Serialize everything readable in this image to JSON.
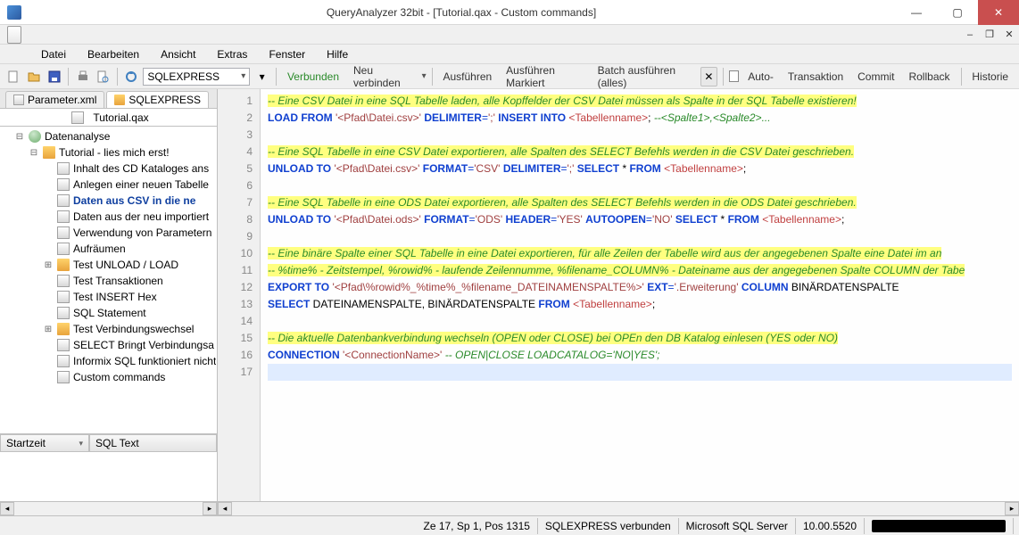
{
  "window": {
    "title": "QueryAnalyzer 32bit - [Tutorial.qax - Custom commands]"
  },
  "menu": [
    "Datei",
    "Bearbeiten",
    "Ansicht",
    "Extras",
    "Fenster",
    "Hilfe"
  ],
  "toolbar": {
    "connection": "SQLEXPRESS",
    "status": "Verbunden",
    "reconnect": "Neu verbinden",
    "execute": "Ausführen",
    "executeMarked": "Ausführen Markiert",
    "batchAll": "Batch ausführen (alles)",
    "auto": "Auto-",
    "transaction": "Transaktion",
    "commit": "Commit",
    "rollback": "Rollback",
    "history": "Historie"
  },
  "sidebar": {
    "tabs": [
      "Parameter.xml",
      "SQLEXPRESS"
    ],
    "file": "Tutorial.qax",
    "tree": {
      "root": "Datenanalyse",
      "tutorial": "Tutorial - lies mich erst!",
      "items": [
        "Inhalt des CD Kataloges ans",
        "Anlegen einer neuen Tabelle",
        "Daten aus CSV in die ne",
        "Daten aus der neu importiert",
        "Verwendung von Parametern",
        "Aufräumen",
        "Test UNLOAD / LOAD",
        "Test Transaktionen",
        "Test INSERT Hex",
        "SQL Statement",
        "Test Verbindungswechsel",
        "SELECT Bringt Verbindungsa",
        "Informix SQL funktioniert nicht",
        "Custom commands"
      ]
    },
    "grid": {
      "col1": "Startzeit",
      "col2": "SQL Text"
    }
  },
  "editor": {
    "lines": [
      {
        "n": 1,
        "hl": true,
        "seg": [
          {
            "c": "cm",
            "t": "-- Eine CSV Datei in eine SQL Tabelle laden, alle Kopffelder der CSV Datei müssen als Spalte in der SQL Tabelle existieren!"
          }
        ]
      },
      {
        "n": 2,
        "seg": [
          {
            "c": "kw",
            "t": "LOAD FROM"
          },
          {
            "t": " "
          },
          {
            "c": "st",
            "t": "'<Pfad\\Datei.csv>'"
          },
          {
            "t": " "
          },
          {
            "c": "kw",
            "t": "DELIMITER"
          },
          {
            "c": "op",
            "t": "="
          },
          {
            "c": "st",
            "t": "';'"
          },
          {
            "t": " "
          },
          {
            "c": "kw",
            "t": "INSERT INTO"
          },
          {
            "t": " "
          },
          {
            "c": "tag",
            "t": "<Tabellenname>"
          },
          {
            "t": "; "
          },
          {
            "c": "cm",
            "t": "--<Spalte1>,<Spalte2>..."
          }
        ]
      },
      {
        "n": 3,
        "seg": []
      },
      {
        "n": 4,
        "hl": true,
        "seg": [
          {
            "c": "cm",
            "t": "-- Eine SQL Tabelle in eine CSV Datei exportieren, alle Spalten des SELECT Befehls werden in die CSV Datei geschrieben."
          }
        ]
      },
      {
        "n": 5,
        "seg": [
          {
            "c": "kw",
            "t": "UNLOAD TO"
          },
          {
            "t": " "
          },
          {
            "c": "st",
            "t": "'<Pfad\\Datei.csv>'"
          },
          {
            "t": " "
          },
          {
            "c": "kw",
            "t": "FORMAT"
          },
          {
            "c": "op",
            "t": "="
          },
          {
            "c": "st",
            "t": "'CSV'"
          },
          {
            "t": " "
          },
          {
            "c": "kw",
            "t": "DELIMITER"
          },
          {
            "c": "op",
            "t": "="
          },
          {
            "c": "st",
            "t": "';'"
          },
          {
            "t": " "
          },
          {
            "c": "kw",
            "t": "SELECT"
          },
          {
            "t": " * "
          },
          {
            "c": "kw",
            "t": "FROM"
          },
          {
            "t": " "
          },
          {
            "c": "tag",
            "t": "<Tabellenname>"
          },
          {
            "t": ";"
          }
        ]
      },
      {
        "n": 6,
        "seg": []
      },
      {
        "n": 7,
        "hl": true,
        "seg": [
          {
            "c": "cm",
            "t": "-- Eine SQL Tabelle in eine ODS Datei exportieren, alle Spalten des SELECT Befehls werden in die ODS Datei geschrieben."
          }
        ]
      },
      {
        "n": 8,
        "seg": [
          {
            "c": "kw",
            "t": "UNLOAD TO"
          },
          {
            "t": " "
          },
          {
            "c": "st",
            "t": "'<Pfad\\Datei.ods>'"
          },
          {
            "t": " "
          },
          {
            "c": "kw",
            "t": "FORMAT"
          },
          {
            "c": "op",
            "t": "="
          },
          {
            "c": "st",
            "t": "'ODS'"
          },
          {
            "t": " "
          },
          {
            "c": "kw",
            "t": "HEADER"
          },
          {
            "c": "op",
            "t": "="
          },
          {
            "c": "st",
            "t": "'YES'"
          },
          {
            "t": " "
          },
          {
            "c": "kw",
            "t": "AUTOOPEN"
          },
          {
            "c": "op",
            "t": "="
          },
          {
            "c": "st",
            "t": "'NO'"
          },
          {
            "t": " "
          },
          {
            "c": "kw",
            "t": "SELECT"
          },
          {
            "t": " * "
          },
          {
            "c": "kw",
            "t": "FROM"
          },
          {
            "t": " "
          },
          {
            "c": "tag",
            "t": "<Tabellenname>"
          },
          {
            "t": ";"
          }
        ]
      },
      {
        "n": 9,
        "seg": []
      },
      {
        "n": 10,
        "hl": true,
        "seg": [
          {
            "c": "cm",
            "t": "-- Eine binäre Spalte einer SQL Tabelle in eine Datei exportieren, für alle Zeilen der Tabelle wird aus der angegebenen Spalte eine Datei im an"
          }
        ]
      },
      {
        "n": 11,
        "hl": true,
        "seg": [
          {
            "c": "cm",
            "t": "-- %time% - Zeitstempel, %rowid% - laufende Zeilennumme, %filename_COLUMN% - Dateiname aus der angegebenen Spalte COLUMN der Tabe"
          }
        ]
      },
      {
        "n": 12,
        "seg": [
          {
            "c": "kw",
            "t": "EXPORT TO"
          },
          {
            "t": " "
          },
          {
            "c": "st",
            "t": "'<Pfad\\%rowid%_%time%_%filename_DATEINAMENSPALTE%>'"
          },
          {
            "t": " "
          },
          {
            "c": "kw",
            "t": "EXT"
          },
          {
            "c": "op",
            "t": "="
          },
          {
            "c": "st",
            "t": "'.Erweiterung'"
          },
          {
            "t": " "
          },
          {
            "c": "kw",
            "t": "COLUMN"
          },
          {
            "t": " BINÄRDATENSPALTE"
          }
        ]
      },
      {
        "n": 13,
        "seg": [
          {
            "c": "kw",
            "t": "SELECT"
          },
          {
            "t": " DATEINAMENSPALTE, BINÄRDATENSPALTE "
          },
          {
            "c": "kw",
            "t": "FROM"
          },
          {
            "t": " "
          },
          {
            "c": "tag",
            "t": "<Tabellenname>"
          },
          {
            "t": ";"
          }
        ]
      },
      {
        "n": 14,
        "seg": []
      },
      {
        "n": 15,
        "hl": true,
        "seg": [
          {
            "c": "cm",
            "t": "-- Die aktuelle Datenbankverbindung wechseln (OPEN oder CLOSE) bei OPEn den DB Katalog einlesen (YES oder NO)"
          }
        ]
      },
      {
        "n": 16,
        "seg": [
          {
            "c": "kw",
            "t": "CONNECTION"
          },
          {
            "t": " "
          },
          {
            "c": "st",
            "t": "'<ConnectionName>'"
          },
          {
            "t": " "
          },
          {
            "c": "cm",
            "t": "-- OPEN|CLOSE LOADCATALOG='NO|YES';"
          }
        ]
      },
      {
        "n": 17,
        "cur": true,
        "seg": []
      }
    ]
  },
  "status": {
    "pos": "Ze 17, Sp 1, Pos 1315",
    "conn": "SQLEXPRESS verbunden",
    "server": "Microsoft SQL Server",
    "ver": "10.00.5520"
  }
}
